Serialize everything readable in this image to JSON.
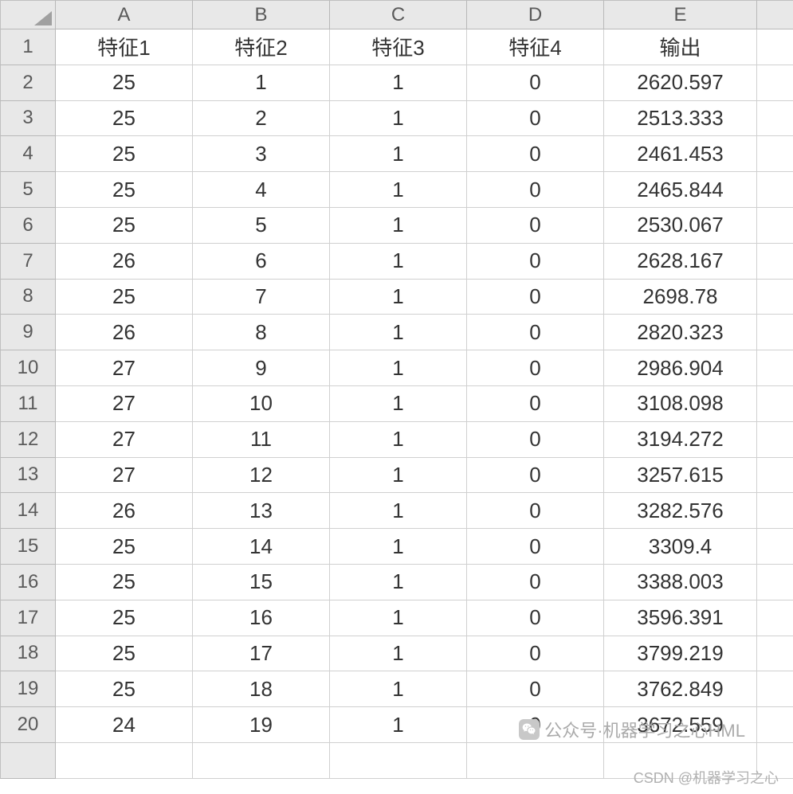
{
  "columns": [
    "A",
    "B",
    "C",
    "D",
    "E"
  ],
  "rowNumbers": [
    "1",
    "2",
    "3",
    "4",
    "5",
    "6",
    "7",
    "8",
    "9",
    "10",
    "11",
    "12",
    "13",
    "14",
    "15",
    "16",
    "17",
    "18",
    "19",
    "20"
  ],
  "headerRow": [
    "特征1",
    "特征2",
    "特征3",
    "特征4",
    "输出"
  ],
  "data": [
    [
      "25",
      "1",
      "1",
      "0",
      "2620.597"
    ],
    [
      "25",
      "2",
      "1",
      "0",
      "2513.333"
    ],
    [
      "25",
      "3",
      "1",
      "0",
      "2461.453"
    ],
    [
      "25",
      "4",
      "1",
      "0",
      "2465.844"
    ],
    [
      "25",
      "5",
      "1",
      "0",
      "2530.067"
    ],
    [
      "26",
      "6",
      "1",
      "0",
      "2628.167"
    ],
    [
      "25",
      "7",
      "1",
      "0",
      "2698.78"
    ],
    [
      "26",
      "8",
      "1",
      "0",
      "2820.323"
    ],
    [
      "27",
      "9",
      "1",
      "0",
      "2986.904"
    ],
    [
      "27",
      "10",
      "1",
      "0",
      "3108.098"
    ],
    [
      "27",
      "11",
      "1",
      "0",
      "3194.272"
    ],
    [
      "27",
      "12",
      "1",
      "0",
      "3257.615"
    ],
    [
      "26",
      "13",
      "1",
      "0",
      "3282.576"
    ],
    [
      "25",
      "14",
      "1",
      "0",
      "3309.4"
    ],
    [
      "25",
      "15",
      "1",
      "0",
      "3388.003"
    ],
    [
      "25",
      "16",
      "1",
      "0",
      "3596.391"
    ],
    [
      "25",
      "17",
      "1",
      "0",
      "3799.219"
    ],
    [
      "25",
      "18",
      "1",
      "0",
      "3762.849"
    ],
    [
      "24",
      "19",
      "1",
      "0",
      "3672.559"
    ]
  ],
  "watermark1": "公众号·机器学习之心HML",
  "watermark2": "CSDN @机器学习之心"
}
